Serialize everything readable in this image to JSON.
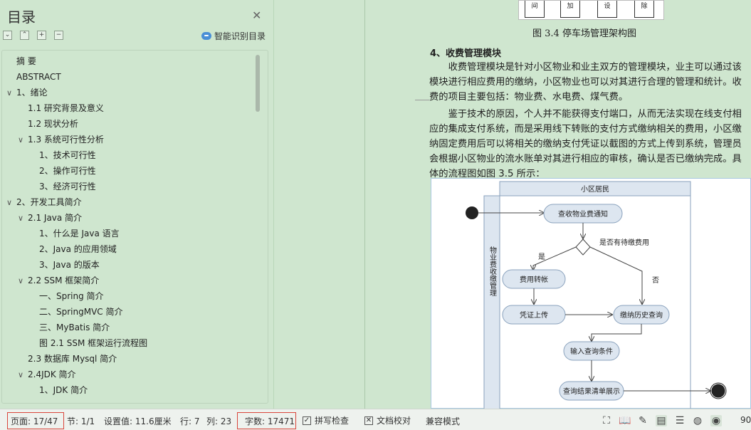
{
  "toc": {
    "title": "目录",
    "smart_label": "智能识别目录",
    "items": [
      {
        "label": "摘  要",
        "level": 0
      },
      {
        "label": "ABSTRACT",
        "level": 0
      },
      {
        "label": "1、绪论",
        "level": 0,
        "expanded": true
      },
      {
        "label": "1.1 研究背景及意义",
        "level": 1
      },
      {
        "label": "1.2 现状分析",
        "level": 1
      },
      {
        "label": "1.3 系统可行性分析",
        "level": 1,
        "expanded": true
      },
      {
        "label": "1、技术可行性",
        "level": 2
      },
      {
        "label": "2、操作可行性",
        "level": 2
      },
      {
        "label": "3、经济可行性",
        "level": 2
      },
      {
        "label": "2、开发工具简介",
        "level": 0,
        "expanded": true
      },
      {
        "label": "2.1   Java 简介",
        "level": 1,
        "expanded": true
      },
      {
        "label": "1、什么是 Java 语言",
        "level": 2
      },
      {
        "label": "2、Java 的应用领域",
        "level": 2
      },
      {
        "label": "3、Java 的版本",
        "level": 2
      },
      {
        "label": "2.2   SSM 框架简介",
        "level": 1,
        "expanded": true
      },
      {
        "label": "一、Spring 简介",
        "level": 2
      },
      {
        "label": "二、SpringMVC 简介",
        "level": 2
      },
      {
        "label": "三、MyBatis 简介",
        "level": 2
      },
      {
        "label": "图 2.1   SSM 框架运行流程图",
        "level": 2
      },
      {
        "label": "2.3   数据库 Mysql 简介",
        "level": 1
      },
      {
        "label": "2.4JDK 简介",
        "level": 1,
        "expanded": true
      },
      {
        "label": "1、JDK 简介",
        "level": 2
      }
    ]
  },
  "document": {
    "fig_top_boxes": [
      "间",
      "加",
      "设",
      "除"
    ],
    "figure_caption": "图 3.4  停车场管理架构图",
    "section_heading": "4、收费管理模块",
    "para1": "　　收费管理模块是针对小区物业和业主双方的管理模块，业主可以通过该模块进行相应费用的缴纳，小区物业也可以对其进行合理的管理和统计。收费的项目主要包括：物业费、水电费、煤气费。",
    "para2": "　　鉴于技术的原因，个人并不能获得支付端口，从而无法实现在线支付相应的集成支付系统，而是采用线下转账的支付方式缴纳相关的费用，小区缴纳固定费用后可以将相关的缴纳支付凭证以截图的方式上传到系统，管理员会根据小区物业的流水账单对其进行相应的审核，确认是否已缴纳完成。具体的流程图如图 3.5 所示：",
    "flowchart": {
      "swimlane_top": "小区居民",
      "swimlane_left": "物业费收缴管理",
      "nodes": {
        "check_notice": "查收物业费通知",
        "decision": "是否有待缴费用",
        "yes": "是",
        "no": "否",
        "transfer": "费用转帐",
        "upload": "凭证上传",
        "history": "缴纳历史查询",
        "input": "输入查询条件",
        "result": "查询结果清单展示"
      }
    }
  },
  "status": {
    "page": "页面: 17/47",
    "section": "节: 1/1",
    "setting": "设置值: 11.6厘米",
    "row": "行: 7",
    "col": "列: 23",
    "word_count": "字数: 17471",
    "spell_check": "拼写检查",
    "doc_proof": "文档校对",
    "compat_mode": "兼容模式",
    "zoom": "90"
  }
}
